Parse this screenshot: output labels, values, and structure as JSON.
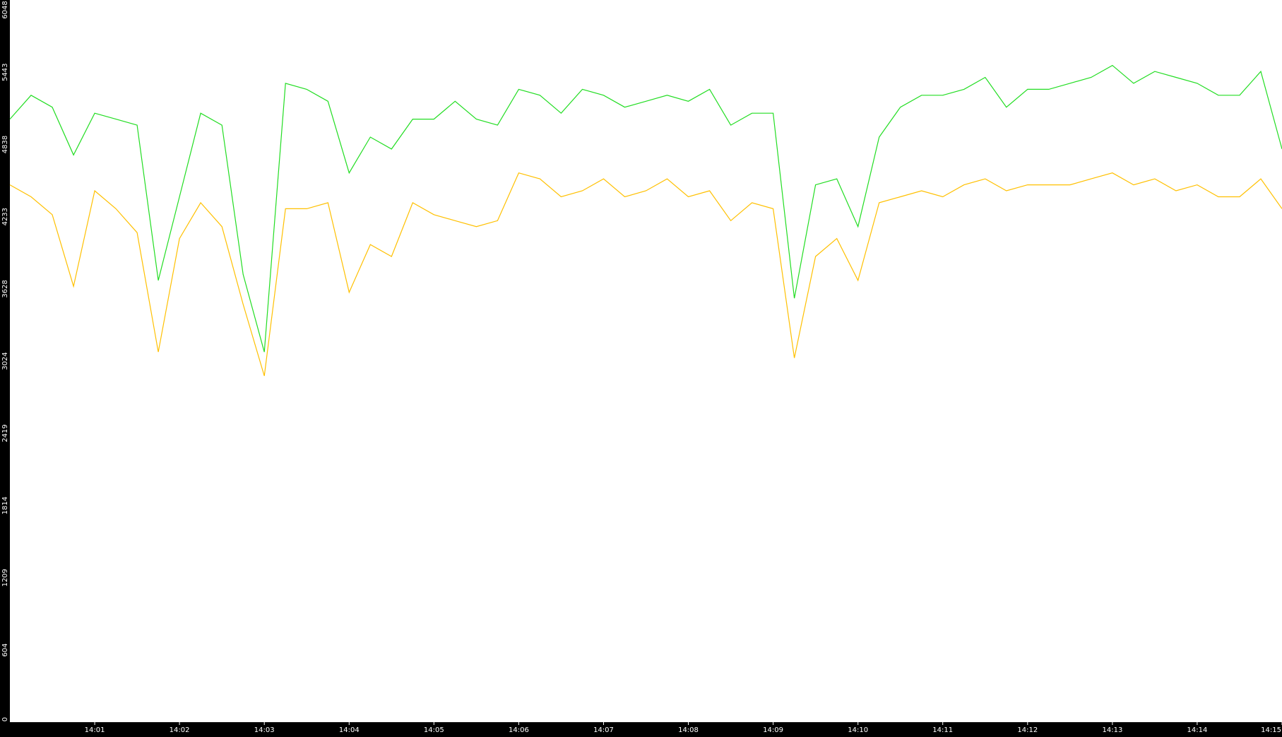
{
  "chart_data": {
    "type": "line",
    "title": "",
    "xlabel": "",
    "ylabel": "",
    "y_ticks": [
      "0",
      "604",
      "1209",
      "1814",
      "2419",
      "3024",
      "3628",
      "4233",
      "4838",
      "5443",
      "6048"
    ],
    "y_values": [
      0,
      604,
      1209,
      1814,
      2419,
      3024,
      3628,
      4233,
      4838,
      5443,
      6048
    ],
    "ylim": [
      0,
      6048
    ],
    "x_ticks": [
      "14:01",
      "14:02",
      "14:03",
      "14:04",
      "14:05",
      "14:06",
      "14:07",
      "14:08",
      "14:09",
      "14:10",
      "14:11",
      "14:12",
      "14:13",
      "14:14",
      "14:15"
    ],
    "xlim_minutes": [
      0.0,
      15.0
    ],
    "x_tick_minutes": [
      1,
      2,
      3,
      4,
      5,
      6,
      7,
      8,
      9,
      10,
      11,
      12,
      13,
      14,
      15
    ],
    "grid": false,
    "legend": "none",
    "colors": {
      "background": "#ffffff",
      "frame": "#000000",
      "axis_text": "#ffffff",
      "series_upper": "#22dd22",
      "series_lower": "#ffc000"
    },
    "series": [
      {
        "color": "#22dd22",
        "x_minutes": [
          0.0,
          0.25,
          0.5,
          0.75,
          1.0,
          1.25,
          1.5,
          1.75,
          2.0,
          2.25,
          2.5,
          2.75,
          3.0,
          3.25,
          3.5,
          3.75,
          4.0,
          4.25,
          4.5,
          4.75,
          5.0,
          5.25,
          5.5,
          5.75,
          6.0,
          6.25,
          6.5,
          6.75,
          7.0,
          7.25,
          7.5,
          7.75,
          8.0,
          8.25,
          8.5,
          8.75,
          9.0,
          9.25,
          9.5,
          9.75,
          10.0,
          10.25,
          10.5,
          10.75,
          11.0,
          11.25,
          11.5,
          11.75,
          12.0,
          12.25,
          12.5,
          12.75,
          13.0,
          13.25,
          13.5,
          13.75,
          14.0,
          14.25,
          14.5,
          14.75,
          15.0
        ],
        "values": [
          5050,
          5250,
          5150,
          4750,
          5100,
          5050,
          5000,
          3700,
          4400,
          5100,
          5000,
          3750,
          3100,
          5350,
          5300,
          5200,
          4600,
          4900,
          4800,
          5050,
          5050,
          5200,
          5050,
          5000,
          5300,
          5250,
          5100,
          5300,
          5250,
          5150,
          5200,
          5250,
          5200,
          5300,
          5000,
          5100,
          5100,
          3550,
          4500,
          4550,
          4150,
          4900,
          5150,
          5250,
          5250,
          5300,
          5400,
          5150,
          5300,
          5300,
          5350,
          5400,
          5500,
          5350,
          5450,
          5400,
          5350,
          5250,
          5250,
          5450,
          4800
        ]
      },
      {
        "color": "#ffc000",
        "x_minutes": [
          0.0,
          0.25,
          0.5,
          0.75,
          1.0,
          1.25,
          1.5,
          1.75,
          2.0,
          2.25,
          2.5,
          2.75,
          3.0,
          3.25,
          3.5,
          3.75,
          4.0,
          4.25,
          4.5,
          4.75,
          5.0,
          5.25,
          5.5,
          5.75,
          6.0,
          6.25,
          6.5,
          6.75,
          7.0,
          7.25,
          7.5,
          7.75,
          8.0,
          8.25,
          8.5,
          8.75,
          9.0,
          9.25,
          9.5,
          9.75,
          10.0,
          10.25,
          10.5,
          10.75,
          11.0,
          11.25,
          11.5,
          11.75,
          12.0,
          12.25,
          12.5,
          12.75,
          13.0,
          13.25,
          13.5,
          13.75,
          14.0,
          14.25,
          14.5,
          14.75,
          15.0
        ],
        "values": [
          4500,
          4400,
          4250,
          3650,
          4450,
          4300,
          4100,
          3100,
          4050,
          4350,
          4150,
          3500,
          2900,
          4300,
          4300,
          4350,
          3600,
          4000,
          3900,
          4350,
          4250,
          4200,
          4150,
          4200,
          4600,
          4550,
          4400,
          4450,
          4550,
          4400,
          4450,
          4550,
          4400,
          4450,
          4200,
          4350,
          4300,
          3050,
          3900,
          4050,
          3700,
          4350,
          4400,
          4450,
          4400,
          4500,
          4550,
          4450,
          4500,
          4500,
          4500,
          4550,
          4600,
          4500,
          4550,
          4450,
          4500,
          4400,
          4400,
          4550,
          4300
        ]
      }
    ]
  }
}
